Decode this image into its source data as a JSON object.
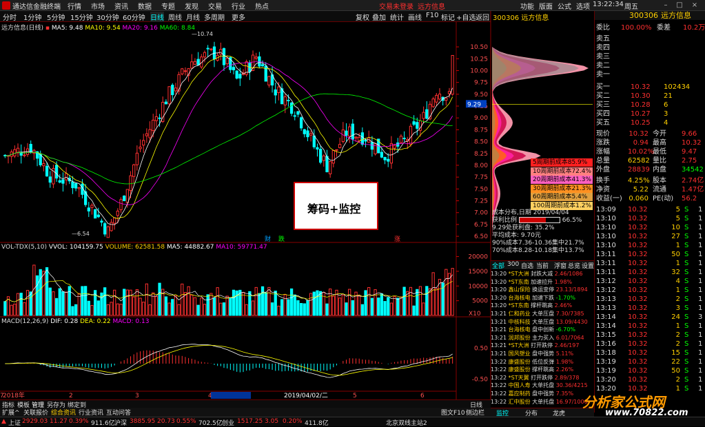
{
  "app": {
    "title": "通达信金融终端",
    "menu": [
      "行情",
      "市场",
      "资讯",
      "数据",
      "专题",
      "发现",
      "交易",
      "行业",
      "热点"
    ],
    "login": "交易未登录",
    "brand": "远方信息",
    "menu_right": [
      "功能",
      "版面",
      "公式",
      "选项",
      "帮助"
    ],
    "time": "13:22:34",
    "weekday": "周五"
  },
  "toolbar": {
    "periods": [
      "分时",
      "1分钟",
      "5分钟",
      "15分钟",
      "30分钟",
      "60分钟",
      "日线",
      "周线",
      "月线",
      "多周期",
      "更多"
    ],
    "right": [
      "复权",
      "叠加",
      "统计",
      "画线",
      "F10",
      "标记",
      "+自选",
      "返回"
    ]
  },
  "chart": {
    "stock_line": "远方信息(日线)",
    "ma": {
      "ma5": "MA5: 9.48",
      "ma10": "MA10: 9.54",
      "ma20": "MA20: 9.16",
      "ma60": "MA60: 8.84"
    },
    "high_label": "10.74",
    "low_label": "6.54",
    "price_ticks": [
      "10.50",
      "10.25",
      "10.00",
      "9.75",
      "9.50",
      "9.25",
      "9.00",
      "8.75",
      "8.50",
      "8.25",
      "8.00",
      "7.75",
      "7.50",
      "7.25",
      "7.00",
      "6.75",
      "6.50"
    ],
    "cur_price": "9.29",
    "events": [
      "财",
      "跌",
      "涨"
    ],
    "x_labels": [
      "2018年",
      "2",
      "3",
      "4",
      "2019/04/02/二",
      "5",
      "6",
      "7"
    ],
    "popup": "筹码+监控"
  },
  "volume": {
    "title": "VOL-TDX(5,10)",
    "vvol": "VVOL: 104159.75",
    "volume": "VOLUME: 62581.58",
    "ma5": "MA5: 44882.67",
    "ma10": "MA10: 59771.47",
    "ticks": [
      "20000",
      "15000",
      "10000",
      "5000"
    ],
    "unit": "X10"
  },
  "macd": {
    "title": "MACD(12,26,9)",
    "dif": "DIF: 0.28",
    "dea": "DEA: 0.22",
    "macd": "MACD: 0.13",
    "ticks": [
      "0.50",
      "-0.50"
    ]
  },
  "cost": {
    "code": "300306",
    "name": "远方信息",
    "legend": [
      "5周期前成本85.9%",
      "10周期前成本72.4%",
      "20周期前成本41.3%",
      "30周期前成本21.3%",
      "60周期前成本5.4%",
      "100周期前成本1.2%"
    ],
    "legend_colors": [
      "#ff2020",
      "#ff8080",
      "#ff60c0",
      "#ff9020",
      "#e0a040",
      "#ffd060"
    ],
    "date_label": "成本分布,日期",
    "date": "2019/04/04",
    "ratio_label": "获利比例",
    "ratio": "66.5%",
    "profit_label": "9.29处获利盘:",
    "profit": "35.2%",
    "avg_label": "平均成本:",
    "avg": "9.70元",
    "c90": "90%成本7.36-10.36集中21.7%",
    "c70": "70%成本8.28-10.18集中13.7%"
  },
  "monitor": {
    "tabs": [
      "全部",
      "300",
      "自选",
      "当前",
      "浮窗",
      "总览",
      "设置"
    ],
    "rows": [
      [
        "13:20",
        "*ST大洲",
        "封跌大减",
        "2.46/1086"
      ],
      [
        "13:20",
        "*ST东南",
        "加速拉升",
        "1.98%"
      ],
      [
        "13:20",
        "鑫山保险",
        "换运变停",
        "23.13/1894"
      ],
      [
        "13:20",
        "台海核电",
        "加速下跌",
        "-1.70%"
      ],
      [
        "13:20",
        "*ST东南",
        "撑杆跳高",
        "2.46%"
      ],
      [
        "13:21",
        "仁和药业",
        "大单压盘",
        "7.30/7385"
      ],
      [
        "13:21",
        "中核科技",
        "大单压盘",
        "13.09/4430"
      ],
      [
        "13:21",
        "台海核电",
        "盘中创新",
        "-6.70%"
      ],
      [
        "13:21",
        "润邦股份",
        "主力买入",
        "6.01/7064"
      ],
      [
        "13:21",
        "*ST大洲",
        "打开跌停",
        "2.46/197"
      ],
      [
        "13:21",
        "国风塑业",
        "盘中强势",
        "5.11%"
      ],
      [
        "13:22",
        "康盛股份",
        "低位反弹",
        "1.98%"
      ],
      [
        "13:22",
        "康盛股份",
        "撑杆跳高",
        "2.26%"
      ],
      [
        "13:22",
        "*ST天翼",
        "打开跌停",
        "2.89/378"
      ],
      [
        "13:22",
        "中国人寿",
        "大单托盘",
        "30.36/4215"
      ],
      [
        "13:22",
        "嘉应制药",
        "盘中强势",
        "7.35%"
      ],
      [
        "13:22",
        "汇中股份",
        "大单托盘",
        "16.97/1000"
      ]
    ],
    "bottom_tabs": [
      "监控",
      "分布",
      "龙虎"
    ]
  },
  "quote": {
    "code": "300306",
    "name": "远方信息",
    "weibi_label": "委比",
    "weibi": "100.00%",
    "weicha_label": "委差",
    "weicha": "10.2万",
    "asks": [
      "卖五",
      "卖四",
      "卖三",
      "卖二",
      "卖一"
    ],
    "bids": [
      [
        "买一",
        "10.32",
        "102434"
      ],
      [
        "买二",
        "10.30",
        "21"
      ],
      [
        "买三",
        "10.28",
        "6"
      ],
      [
        "买四",
        "10.27",
        "3"
      ],
      [
        "买五",
        "10.25",
        "4"
      ]
    ],
    "stats": [
      [
        "现价",
        "10.32",
        "今开",
        "9.66"
      ],
      [
        "涨跌",
        "0.94",
        "最高",
        "10.32"
      ],
      [
        "涨幅",
        "10.02%",
        "最低",
        "9.47"
      ],
      [
        "总量",
        "62582",
        "量比",
        "2.75"
      ],
      [
        "外盘",
        "28839",
        "内盘",
        "34542"
      ],
      [
        "换手",
        "4.25%",
        "股本",
        "2.74亿"
      ],
      [
        "净资",
        "5.22",
        "流通",
        "1.47亿"
      ],
      [
        "收益(一)",
        "0.060",
        "PE(动)",
        "56.2"
      ]
    ],
    "ticks": [
      [
        "13:09",
        "10.32",
        "5",
        "S",
        "1"
      ],
      [
        "13:10",
        "10.32",
        "5",
        "S",
        "1"
      ],
      [
        "13:10",
        "10.32",
        "10",
        "S",
        "1"
      ],
      [
        "13:10",
        "10.32",
        "27",
        "S",
        "1"
      ],
      [
        "13:10",
        "10.32",
        "1",
        "S",
        "1"
      ],
      [
        "13:11",
        "10.32",
        "50",
        "S",
        "1"
      ],
      [
        "13:11",
        "10.32",
        "1",
        "S",
        "1"
      ],
      [
        "13:11",
        "10.32",
        "32",
        "S",
        "1"
      ],
      [
        "13:12",
        "10.32",
        "4",
        "S",
        "1"
      ],
      [
        "13:12",
        "10.32",
        "1",
        "S",
        "1"
      ],
      [
        "13:13",
        "10.32",
        "2",
        "S",
        "1"
      ],
      [
        "13:13",
        "10.32",
        "3",
        "S",
        "1"
      ],
      [
        "13:14",
        "10.32",
        "24",
        "S",
        "3"
      ],
      [
        "13:14",
        "10.32",
        "1",
        "S",
        "1"
      ],
      [
        "13:15",
        "10.32",
        "2",
        "S",
        "1"
      ],
      [
        "13:16",
        "10.32",
        "2",
        "S",
        "1"
      ],
      [
        "13:18",
        "10.32",
        "15",
        "S",
        "1"
      ],
      [
        "13:19",
        "10.32",
        "22",
        "S",
        "1"
      ],
      [
        "13:19",
        "10.32",
        "50",
        "S",
        "1"
      ],
      [
        "13:20",
        "10.32",
        "2",
        "S",
        "1"
      ],
      [
        "13:20",
        "10.32",
        "1",
        "S",
        "1"
      ]
    ]
  },
  "bottom": {
    "left_tabs": [
      "指标",
      "模板",
      "管理",
      "另存为",
      "绑定到"
    ],
    "sub_tabs": [
      "扩展^",
      "关联报价",
      "综合资讯",
      "行业资讯",
      "互动问答"
    ],
    "daily": "日线",
    "f10": "图文F10",
    "bar": "侧边栏"
  },
  "status": {
    "sh_label": "上证",
    "sh": "2929.03",
    "sh_chg": "11.27",
    "sh_pct": "0.39%",
    "sh_amt": "911.6亿",
    "sz_label": "沪深",
    "sz": "3885.95",
    "sz_chg": "20.73",
    "sz_pct": "0.55%",
    "sz_amt": "702.5亿",
    "cy_label": "创业",
    "cy": "1517.25",
    "cy_chg": "3.05",
    "cy_pct": "0.20%",
    "cy_amt": "411.8亿",
    "server": "北京双线主站2"
  },
  "watermark": {
    "line1": "分析家公式网",
    "line2": "www.70822.com"
  },
  "colors": {
    "up": "#ff3030",
    "down": "#00ffff",
    "ma5": "#ffffff",
    "ma10": "#ffff00",
    "ma20": "#ff00ff",
    "ma60": "#00ff00",
    "accent": "#ffd000"
  }
}
